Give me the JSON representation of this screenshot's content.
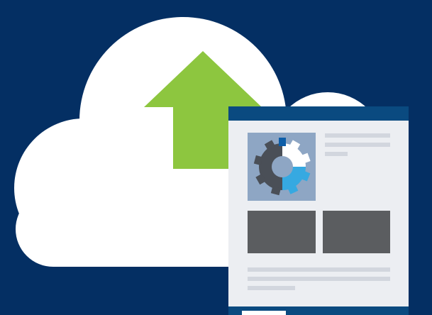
{
  "illustration": {
    "subject": "cloud-upload-with-webpage",
    "colors": {
      "background": "#042f63",
      "cloud": "#ffffff",
      "arrow": "#8dc63f",
      "page_header": "#0a4a80",
      "page_body": "#eceef2",
      "text_line": "#d2d6de",
      "image_panel": "#8ea6c4",
      "gear_dark": "#4a4f57",
      "gear_light": "#ffffff",
      "gear_accent": "#36a9e1",
      "gear_tab": "#0d5ea8",
      "content_block": "#5b5d60"
    }
  }
}
